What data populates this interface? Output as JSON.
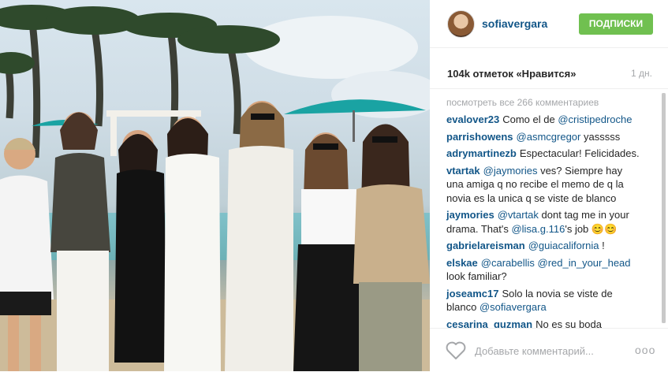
{
  "post": {
    "username": "sofiavergara",
    "follow_label": "ПОДПИСКИ",
    "likes": "104k отметок «Нравится»",
    "age": "1 дн.",
    "view_all": "посмотреть все 266 комментариев",
    "comments": [
      {
        "user": "evalover23",
        "text": "Como el de",
        "mention": "@cristipedroche"
      },
      {
        "user": "parrishowens",
        "text": "",
        "mention": "@asmcgregor",
        "after": " yasssss"
      },
      {
        "user": "adrymartinezb",
        "text": "Espectacular! Felicidades."
      },
      {
        "user": "vtartak",
        "text": "",
        "mention": "@jaymories",
        "after": " ves? Siempre hay una amiga q no recibe el memo de q la novia es la unica q se viste de blanco"
      },
      {
        "user": "jaymories",
        "text": "",
        "mention": "@vtartak",
        "after": " dont tag me in your drama. That's ",
        "mention2": "@lisa.g.116",
        "after2": "'s job 😊😊"
      },
      {
        "user": "gabrielareisman",
        "text": "",
        "mention": "@guiacalifornia",
        "after": " !"
      },
      {
        "user": "elskae",
        "text": "",
        "mention": "@carabellis",
        "after": " ",
        "mention2": "@red_in_your_head",
        "after2": " look familiar?"
      },
      {
        "user": "joseamc17",
        "text": "Solo la novia se viste de blanco",
        "mention": "@sofiavergara"
      },
      {
        "user": "cesarina_guzman",
        "text": "No es su boda"
      }
    ],
    "add_comment_placeholder": "Добавьте комментарий...",
    "more_label": "ooo"
  }
}
